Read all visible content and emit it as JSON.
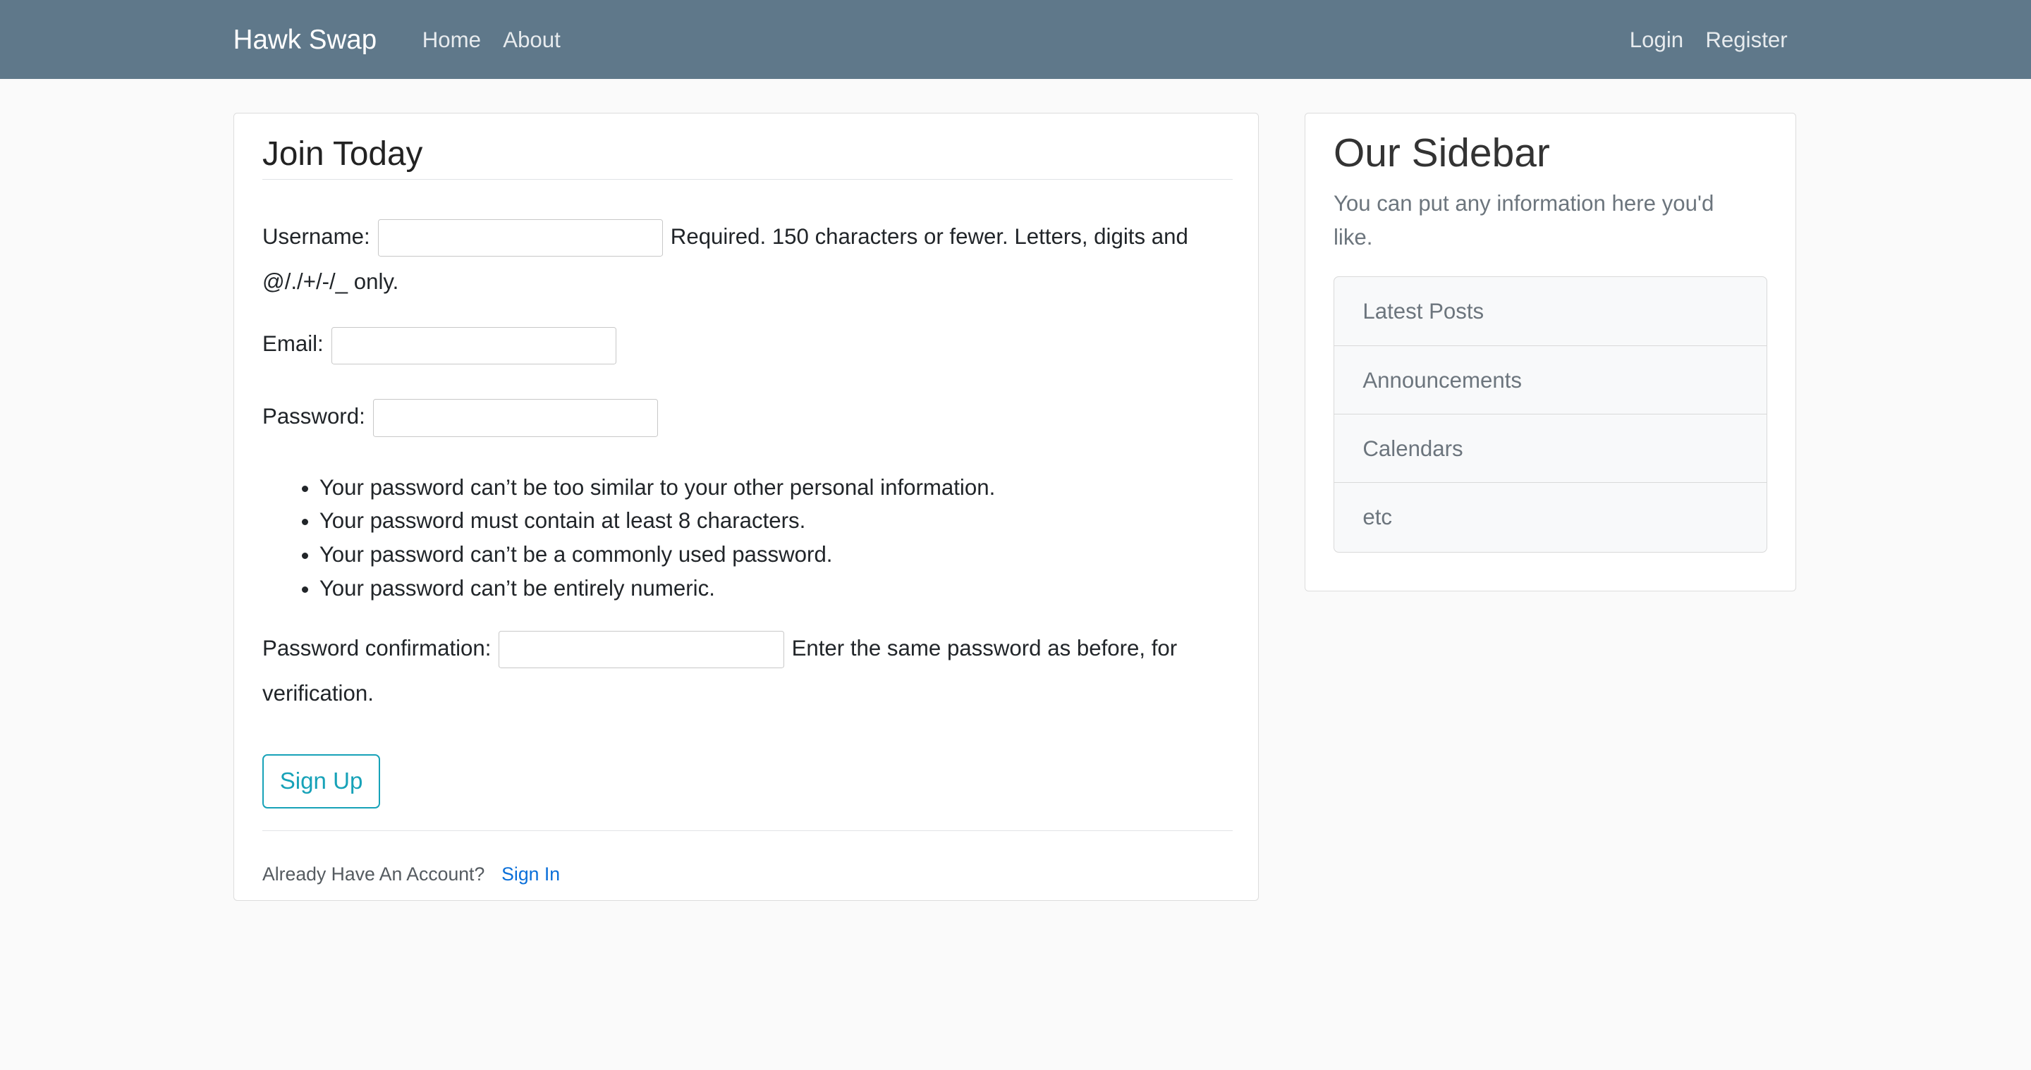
{
  "navbar": {
    "brand": "Hawk Swap",
    "left_links": [
      "Home",
      "About"
    ],
    "right_links": [
      "Login",
      "Register"
    ]
  },
  "form": {
    "title": "Join Today",
    "username_label": "Username:",
    "username_help": "Required. 150 characters or fewer. Letters, digits and @/./+/-/_ only.",
    "email_label": "Email:",
    "password_label": "Password:",
    "password_help": [
      "Your password can’t be too similar to your other personal information.",
      "Your password must contain at least 8 characters.",
      "Your password can’t be a commonly used password.",
      "Your password can’t be entirely numeric."
    ],
    "password_confirm_label": "Password confirmation:",
    "password_confirm_help": "Enter the same password as before, for verification.",
    "submit_label": "Sign Up",
    "footer_text": "Already Have An Account?",
    "footer_link": "Sign In"
  },
  "sidebar": {
    "title": "Our Sidebar",
    "description": "You can put any information here you'd like.",
    "items": [
      "Latest Posts",
      "Announcements",
      "Calendars",
      "etc"
    ]
  },
  "colors": {
    "navbar_bg": "#5f788a",
    "accent": "#17a2b8",
    "link": "#0a6fd9"
  }
}
